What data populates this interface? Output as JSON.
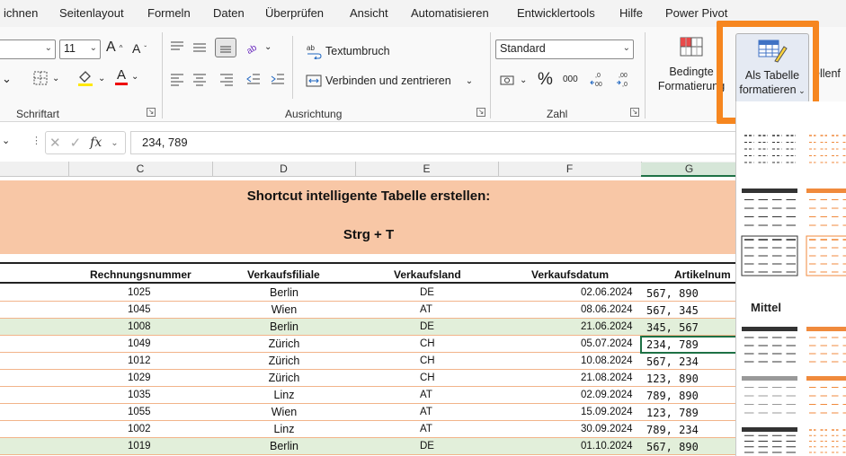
{
  "menu": [
    "ichnen",
    "Seitenlayout",
    "Formeln",
    "Daten",
    "Überprüfen",
    "Ansicht",
    "Automatisieren",
    "Entwicklertools",
    "Hilfe",
    "Power Pivot"
  ],
  "ribbon": {
    "font_size": "11",
    "font_group_label": "Schriftart",
    "align_group_label": "Ausrichtung",
    "number_group_label": "Zahl",
    "wrap_label": "Textumbruch",
    "merge_label": "Verbinden und zentrieren",
    "number_format": "Standard",
    "percent": "%",
    "thousand": "000",
    "cond_format_l1": "Bedingte",
    "cond_format_l2": "Formatierung",
    "table_format_l1": "Als Tabelle",
    "table_format_l2": "formatieren",
    "cell_styles_partial": "ellenf"
  },
  "formula": {
    "fx": "fx",
    "value": "234, 789"
  },
  "columns": [
    "C",
    "D",
    "E",
    "F",
    "G"
  ],
  "banner": {
    "line1": "Shortcut intelligente Tabelle erstellen:",
    "line2": "Strg + T"
  },
  "table": {
    "headers": [
      "Rechnungsnummer",
      "Verkaufsfiliale",
      "Verkaufsland",
      "Verkaufsdatum",
      "Artikelnum"
    ],
    "rows": [
      {
        "nr": "1025",
        "filiale": "Berlin",
        "land": "DE",
        "datum": "02.06.2024",
        "artikel": "567, 890",
        "highlight": false
      },
      {
        "nr": "1045",
        "filiale": "Wien",
        "land": "AT",
        "datum": "08.06.2024",
        "artikel": "567, 345",
        "highlight": false
      },
      {
        "nr": "1008",
        "filiale": "Berlin",
        "land": "DE",
        "datum": "21.06.2024",
        "artikel": "345, 567",
        "highlight": true
      },
      {
        "nr": "1049",
        "filiale": "Zürich",
        "land": "CH",
        "datum": "05.07.2024",
        "artikel": "234, 789",
        "highlight": false
      },
      {
        "nr": "1012",
        "filiale": "Zürich",
        "land": "CH",
        "datum": "10.08.2024",
        "artikel": "567, 234",
        "highlight": false
      },
      {
        "nr": "1029",
        "filiale": "Zürich",
        "land": "CH",
        "datum": "21.08.2024",
        "artikel": "123, 890",
        "highlight": false
      },
      {
        "nr": "1035",
        "filiale": "Linz",
        "land": "AT",
        "datum": "02.09.2024",
        "artikel": "789, 890",
        "highlight": false
      },
      {
        "nr": "1055",
        "filiale": "Wien",
        "land": "AT",
        "datum": "15.09.2024",
        "artikel": "123, 789",
        "highlight": false
      },
      {
        "nr": "1002",
        "filiale": "Linz",
        "land": "AT",
        "datum": "30.09.2024",
        "artikel": "789, 234",
        "highlight": false
      },
      {
        "nr": "1019",
        "filiale": "Berlin",
        "land": "DE",
        "datum": "01.10.2024",
        "artikel": "567, 890",
        "highlight": true
      }
    ]
  },
  "gallery": {
    "section_title": "Mittel"
  },
  "colors": {
    "accent_orange": "#f6861f",
    "banner": "#f8c7a6",
    "row_green": "#e2efda",
    "row_border": "#f2b48a",
    "selection": "#1e7145"
  }
}
